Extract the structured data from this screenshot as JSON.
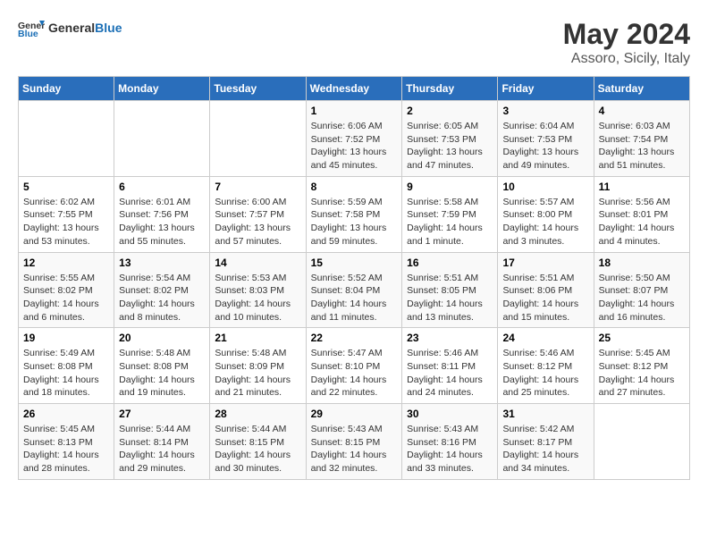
{
  "logo": {
    "text_general": "General",
    "text_blue": "Blue"
  },
  "title": "May 2024",
  "subtitle": "Assoro, Sicily, Italy",
  "headers": [
    "Sunday",
    "Monday",
    "Tuesday",
    "Wednesday",
    "Thursday",
    "Friday",
    "Saturday"
  ],
  "weeks": [
    [
      {
        "day": "",
        "info": ""
      },
      {
        "day": "",
        "info": ""
      },
      {
        "day": "",
        "info": ""
      },
      {
        "day": "1",
        "info": "Sunrise: 6:06 AM\nSunset: 7:52 PM\nDaylight: 13 hours\nand 45 minutes."
      },
      {
        "day": "2",
        "info": "Sunrise: 6:05 AM\nSunset: 7:53 PM\nDaylight: 13 hours\nand 47 minutes."
      },
      {
        "day": "3",
        "info": "Sunrise: 6:04 AM\nSunset: 7:53 PM\nDaylight: 13 hours\nand 49 minutes."
      },
      {
        "day": "4",
        "info": "Sunrise: 6:03 AM\nSunset: 7:54 PM\nDaylight: 13 hours\nand 51 minutes."
      }
    ],
    [
      {
        "day": "5",
        "info": "Sunrise: 6:02 AM\nSunset: 7:55 PM\nDaylight: 13 hours\nand 53 minutes."
      },
      {
        "day": "6",
        "info": "Sunrise: 6:01 AM\nSunset: 7:56 PM\nDaylight: 13 hours\nand 55 minutes."
      },
      {
        "day": "7",
        "info": "Sunrise: 6:00 AM\nSunset: 7:57 PM\nDaylight: 13 hours\nand 57 minutes."
      },
      {
        "day": "8",
        "info": "Sunrise: 5:59 AM\nSunset: 7:58 PM\nDaylight: 13 hours\nand 59 minutes."
      },
      {
        "day": "9",
        "info": "Sunrise: 5:58 AM\nSunset: 7:59 PM\nDaylight: 14 hours\nand 1 minute."
      },
      {
        "day": "10",
        "info": "Sunrise: 5:57 AM\nSunset: 8:00 PM\nDaylight: 14 hours\nand 3 minutes."
      },
      {
        "day": "11",
        "info": "Sunrise: 5:56 AM\nSunset: 8:01 PM\nDaylight: 14 hours\nand 4 minutes."
      }
    ],
    [
      {
        "day": "12",
        "info": "Sunrise: 5:55 AM\nSunset: 8:02 PM\nDaylight: 14 hours\nand 6 minutes."
      },
      {
        "day": "13",
        "info": "Sunrise: 5:54 AM\nSunset: 8:02 PM\nDaylight: 14 hours\nand 8 minutes."
      },
      {
        "day": "14",
        "info": "Sunrise: 5:53 AM\nSunset: 8:03 PM\nDaylight: 14 hours\nand 10 minutes."
      },
      {
        "day": "15",
        "info": "Sunrise: 5:52 AM\nSunset: 8:04 PM\nDaylight: 14 hours\nand 11 minutes."
      },
      {
        "day": "16",
        "info": "Sunrise: 5:51 AM\nSunset: 8:05 PM\nDaylight: 14 hours\nand 13 minutes."
      },
      {
        "day": "17",
        "info": "Sunrise: 5:51 AM\nSunset: 8:06 PM\nDaylight: 14 hours\nand 15 minutes."
      },
      {
        "day": "18",
        "info": "Sunrise: 5:50 AM\nSunset: 8:07 PM\nDaylight: 14 hours\nand 16 minutes."
      }
    ],
    [
      {
        "day": "19",
        "info": "Sunrise: 5:49 AM\nSunset: 8:08 PM\nDaylight: 14 hours\nand 18 minutes."
      },
      {
        "day": "20",
        "info": "Sunrise: 5:48 AM\nSunset: 8:08 PM\nDaylight: 14 hours\nand 19 minutes."
      },
      {
        "day": "21",
        "info": "Sunrise: 5:48 AM\nSunset: 8:09 PM\nDaylight: 14 hours\nand 21 minutes."
      },
      {
        "day": "22",
        "info": "Sunrise: 5:47 AM\nSunset: 8:10 PM\nDaylight: 14 hours\nand 22 minutes."
      },
      {
        "day": "23",
        "info": "Sunrise: 5:46 AM\nSunset: 8:11 PM\nDaylight: 14 hours\nand 24 minutes."
      },
      {
        "day": "24",
        "info": "Sunrise: 5:46 AM\nSunset: 8:12 PM\nDaylight: 14 hours\nand 25 minutes."
      },
      {
        "day": "25",
        "info": "Sunrise: 5:45 AM\nSunset: 8:12 PM\nDaylight: 14 hours\nand 27 minutes."
      }
    ],
    [
      {
        "day": "26",
        "info": "Sunrise: 5:45 AM\nSunset: 8:13 PM\nDaylight: 14 hours\nand 28 minutes."
      },
      {
        "day": "27",
        "info": "Sunrise: 5:44 AM\nSunset: 8:14 PM\nDaylight: 14 hours\nand 29 minutes."
      },
      {
        "day": "28",
        "info": "Sunrise: 5:44 AM\nSunset: 8:15 PM\nDaylight: 14 hours\nand 30 minutes."
      },
      {
        "day": "29",
        "info": "Sunrise: 5:43 AM\nSunset: 8:15 PM\nDaylight: 14 hours\nand 32 minutes."
      },
      {
        "day": "30",
        "info": "Sunrise: 5:43 AM\nSunset: 8:16 PM\nDaylight: 14 hours\nand 33 minutes."
      },
      {
        "day": "31",
        "info": "Sunrise: 5:42 AM\nSunset: 8:17 PM\nDaylight: 14 hours\nand 34 minutes."
      },
      {
        "day": "",
        "info": ""
      }
    ]
  ]
}
